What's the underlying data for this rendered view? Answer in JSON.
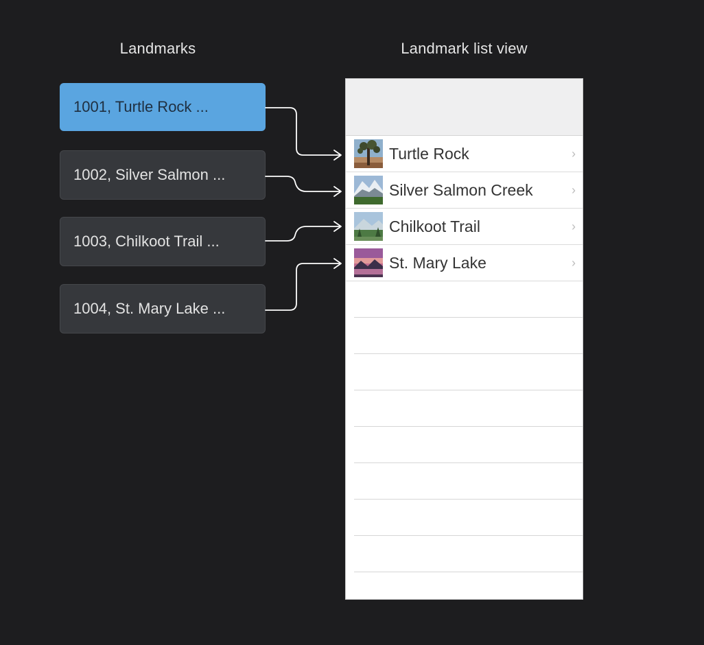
{
  "headers": {
    "left": "Landmarks",
    "right": "Landmark list view"
  },
  "records": [
    {
      "text": "1001, Turtle Rock ...",
      "selected": true
    },
    {
      "text": "1002, Silver Salmon ...",
      "selected": false
    },
    {
      "text": "1003, Chilkoot Trail ...",
      "selected": false
    },
    {
      "text": "1004, St. Mary Lake ...",
      "selected": false
    }
  ],
  "list_rows": [
    {
      "label": "Turtle Rock",
      "thumbnail": "desert-tree-photo"
    },
    {
      "label": "Silver Salmon Creek",
      "thumbnail": "snowy-mountain-photo"
    },
    {
      "label": "Chilkoot Trail",
      "thumbnail": "forest-mountain-photo"
    },
    {
      "label": "St. Mary Lake",
      "thumbnail": "sunset-lake-photo"
    }
  ],
  "chevron": "›",
  "empty_row_count": 9,
  "colors": {
    "background": "#1d1d1f",
    "selected_record": "#5aa5e0",
    "record": "#36383c",
    "connector": "#ffffff"
  }
}
